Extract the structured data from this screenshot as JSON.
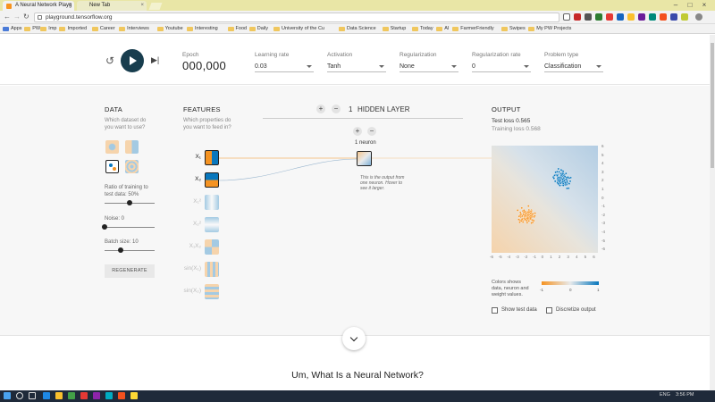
{
  "browser": {
    "tabs": [
      {
        "title": "A Neural Network Playg"
      },
      {
        "title": "New Tab"
      }
    ],
    "url": "playground.tensorflow.org",
    "bookmarks": [
      "Apps",
      "PW",
      "Imp",
      "Imported",
      "Career",
      "Interviews",
      "Youtube",
      "Interesting",
      "Food",
      "Daily",
      "University of the Cu",
      "Data Science",
      "Startup",
      "Today",
      "AI",
      "FarmerFriendly",
      "Swipes",
      "My PW Projects"
    ]
  },
  "controls": {
    "epoch_label": "Epoch",
    "epoch_value": "000,000",
    "learning_rate": {
      "label": "Learning rate",
      "value": "0.03"
    },
    "activation": {
      "label": "Activation",
      "value": "Tanh"
    },
    "regularization": {
      "label": "Regularization",
      "value": "None"
    },
    "regularization_rate": {
      "label": "Regularization rate",
      "value": "0"
    },
    "problem_type": {
      "label": "Problem type",
      "value": "Classification"
    }
  },
  "data_panel": {
    "title": "DATA",
    "subtitle_1": "Which dataset do",
    "subtitle_2": "you want to use?",
    "ratio_label_1": "Ratio of training to",
    "ratio_label_2": "test data:  50%",
    "ratio_value": 0.5,
    "noise_label": "Noise:  0",
    "noise_value": 0,
    "batch_label": "Batch size:  10",
    "batch_value": 0.33,
    "regenerate": "REGENERATE"
  },
  "features_panel": {
    "title": "FEATURES",
    "subtitle_1": "Which properties do",
    "subtitle_2": "you want to feed in?",
    "features": [
      "X₁",
      "X₂",
      "X₁²",
      "X₂²",
      "X₁X₂",
      "sin(X₁)",
      "sin(X₂)"
    ]
  },
  "hidden_layers": {
    "count": "1",
    "label": "HIDDEN LAYER",
    "neurons_label": "1 neuron",
    "tooltip": "This is the output from one neuron. Hover to see it larger."
  },
  "output_panel": {
    "title": "OUTPUT",
    "test_loss": "Test loss 0.565",
    "training_loss": "Training loss 0.568",
    "legend_1": "Colors shows",
    "legend_2": "data, neuron and",
    "legend_3": "weight values.",
    "cbar_ticks": [
      "-1",
      "0",
      "1"
    ],
    "show_test_data": "Show test data",
    "discretize_output": "Discretize output",
    "y_ticks": [
      "6",
      "5",
      "4",
      "3",
      "2",
      "1",
      "0",
      "-1",
      "-2",
      "-3",
      "-4",
      "-5",
      "-6"
    ],
    "x_ticks": [
      "-6",
      "-5",
      "-4",
      "-3",
      "-2",
      "-1",
      "0",
      "1",
      "2",
      "3",
      "4",
      "5",
      "6"
    ]
  },
  "page": {
    "heading": "Um, What Is a Neural Network?"
  },
  "taskbar": {
    "lang": "ENG",
    "time": "3:56 PM"
  },
  "colors": {
    "orange": "#f59322",
    "blue": "#0877bd",
    "dark": "#183d4e"
  }
}
